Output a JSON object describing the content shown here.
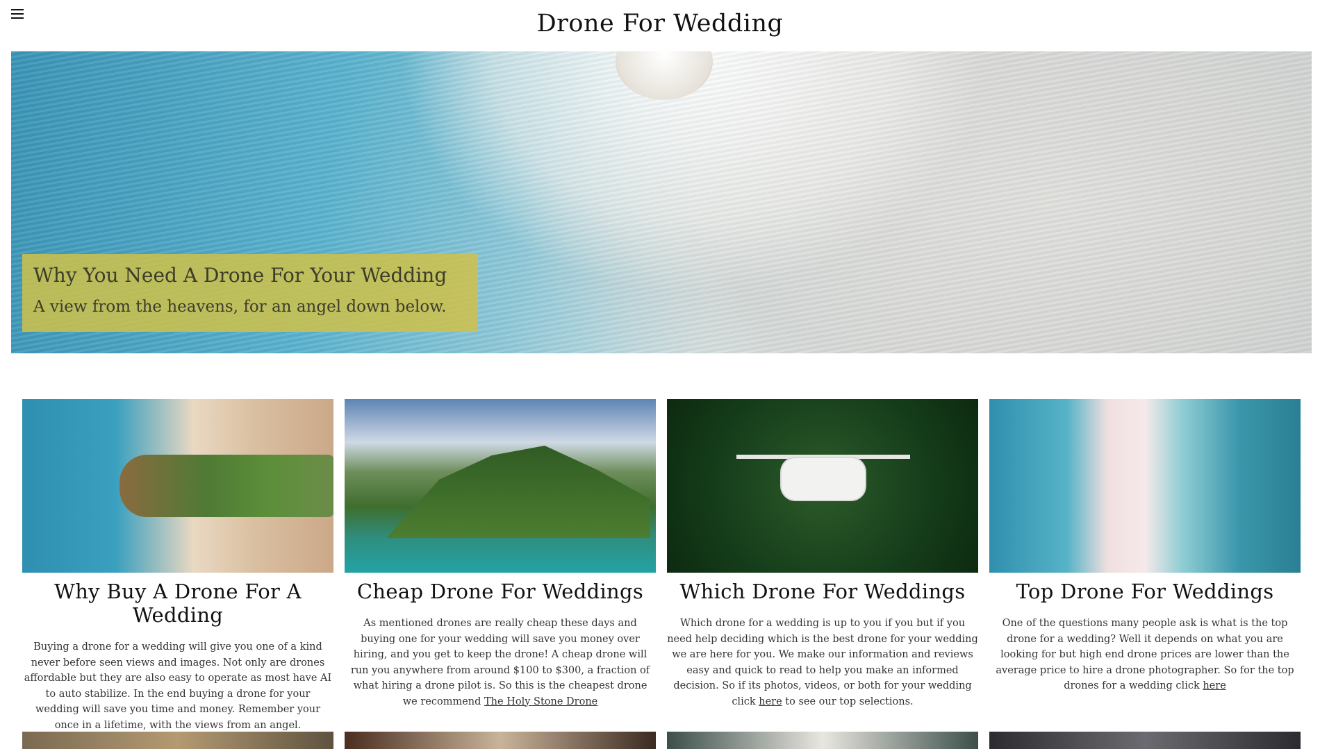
{
  "header": {
    "menu_icon": "hamburger-menu-icon",
    "site_title": "Drone For Wedding"
  },
  "hero": {
    "title": "Why You Need A Drone For Your Wedding",
    "subtitle": "A view from the heavens, for an angel down below.",
    "box_color": "#cfc149"
  },
  "cards": [
    {
      "title": "Why Buy A Drone For A Wedding",
      "text": "Buying a drone for a wedding will give you one of a kind never before seen views and images. Not only are drones affordable but they are also easy to operate as most have AI to auto stabilize. In the end buying a drone for your wedding will save you time and money. Remember your once in a lifetime, with the views from an angel."
    },
    {
      "title": "Cheap Drone For Weddings",
      "text": "As mentioned drones are really cheap these days and buying one for your wedding will save you money over hiring, and you get to keep the drone! A cheap drone will run you anywhere from around $100 to $300, a fraction of what hiring a drone pilot is. So this is the cheapest drone we recommend ",
      "link": "The Holy Stone Drone"
    },
    {
      "title": "Which Drone For Weddings",
      "text": "Which drone for a wedding is up to you if you but if you need help deciding which is the best drone for your wedding we are here for you. We make our information and reviews easy and quick to read to help you make an informed decision. So if its photos, videos, or both for your wedding click ",
      "link": "here",
      "text_after": " to see our top selections."
    },
    {
      "title": "Top Drone For Weddings",
      "text": "One of the questions many people ask is what is the top drone for a wedding? Well it depends on what you are looking for but high end drone prices are lower than the average price to hire a drone photographer. So for the top drones for a wedding click ",
      "link": "here"
    }
  ]
}
